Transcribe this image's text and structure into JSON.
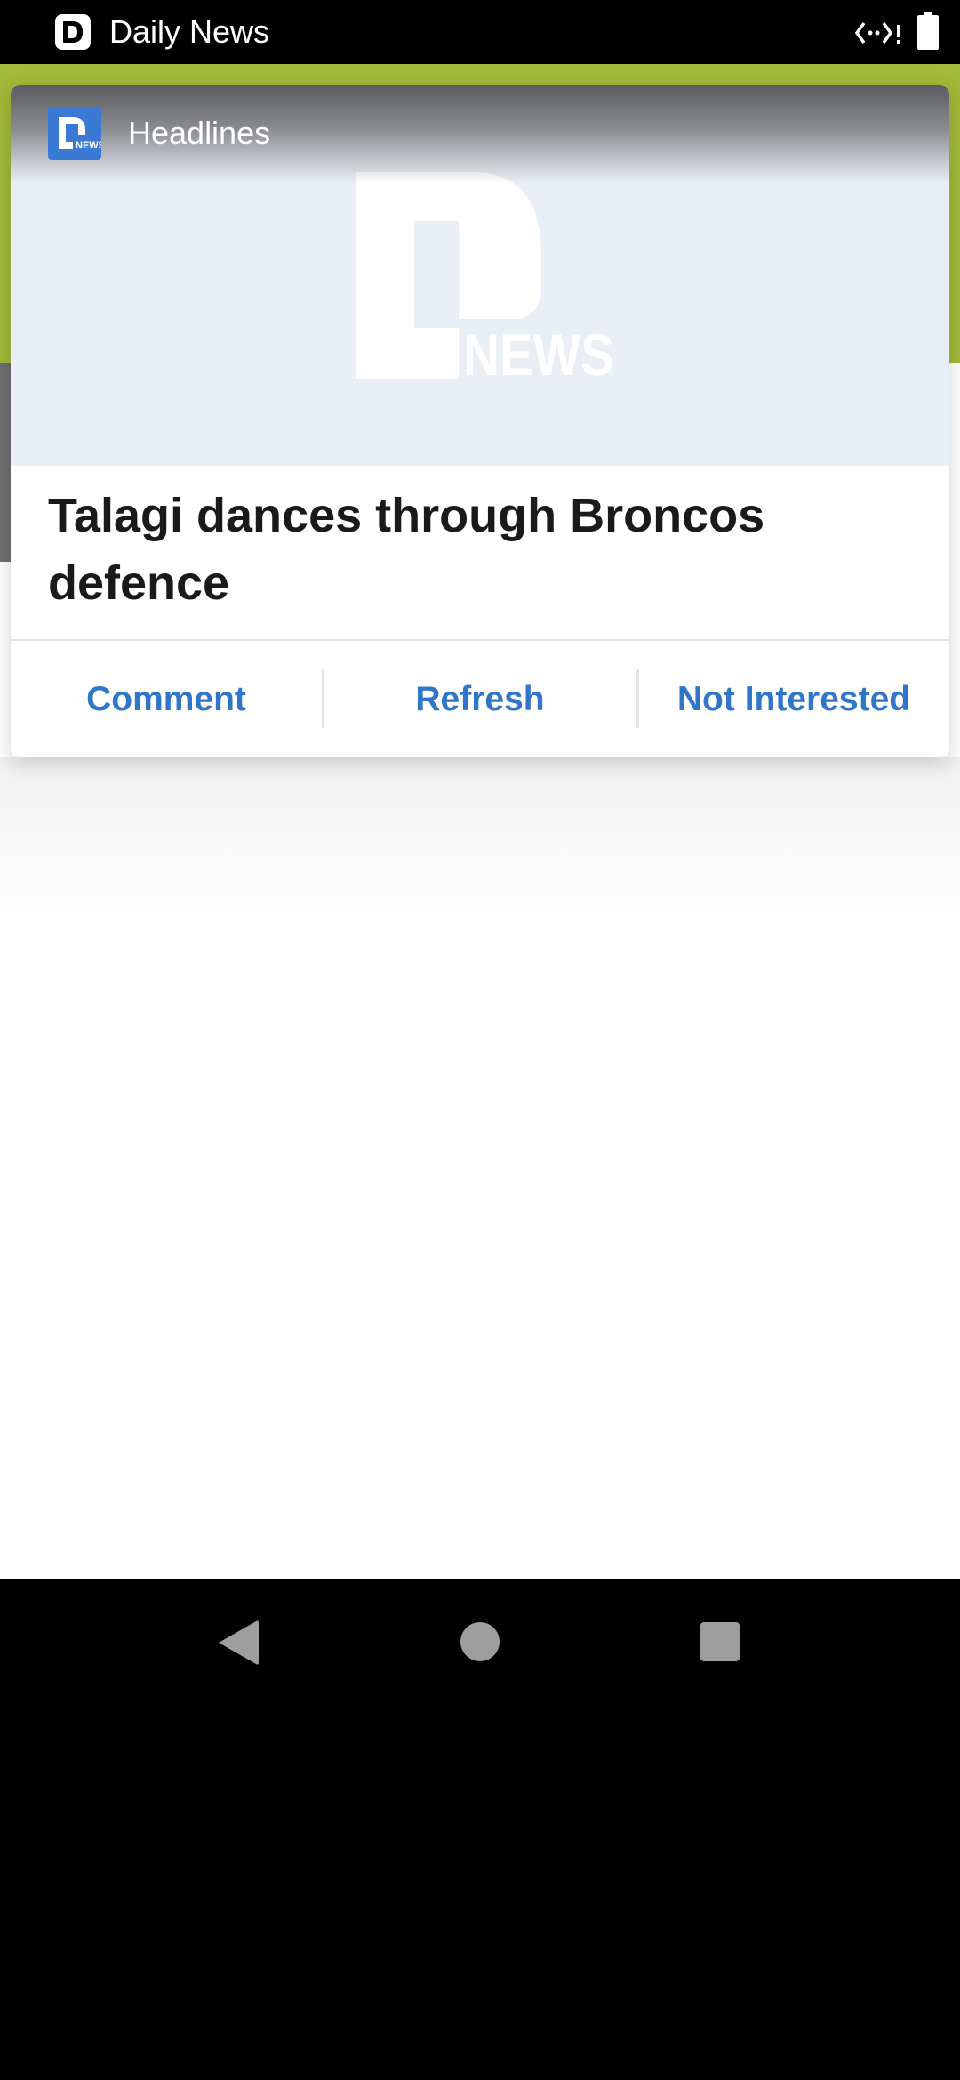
{
  "status_bar": {
    "app_name": "Daily News",
    "app_icon": "daily-news-icon",
    "dev_icon": "dev-debug-icon",
    "battery_icon": "battery-icon"
  },
  "widget": {
    "header_title": "Headlines",
    "logo_icon": "daily-news-logo",
    "hero_logo_text": "NEWS",
    "headline": "Talagi dances through Broncos defence",
    "actions": {
      "comment": "Comment",
      "refresh": "Refresh",
      "not_interested": "Not Interested"
    }
  },
  "nav_bar": {
    "back_icon": "back-icon",
    "home_icon": "home-icon",
    "recents_icon": "recents-icon"
  },
  "colors": {
    "accent_green": "#a3b93a",
    "action_blue": "#2f75c9",
    "logo_blue": "#3a79d4",
    "hero_bg": "#e9eff4"
  }
}
